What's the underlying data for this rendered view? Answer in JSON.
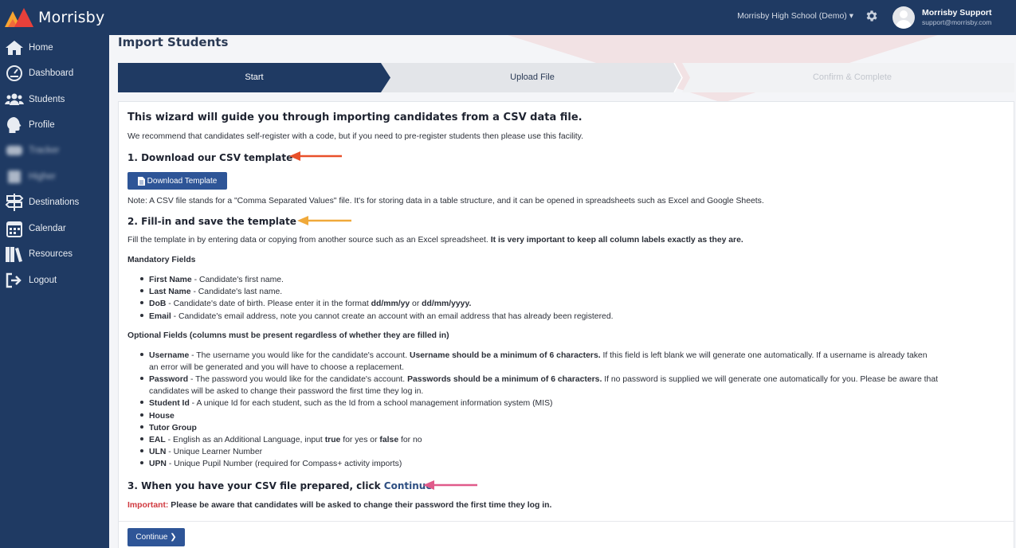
{
  "brand": {
    "name": "Morrisby"
  },
  "header": {
    "school": "Morrisby High School (Demo) ▾",
    "user_name": "Morrisby Support",
    "user_email": "support@morrisby.com"
  },
  "sidebar": {
    "items": [
      {
        "label": "Home",
        "icon": "home-icon"
      },
      {
        "label": "Dashboard",
        "icon": "dashboard-icon"
      },
      {
        "label": "Students",
        "icon": "students-icon"
      },
      {
        "label": "Profile",
        "icon": "profile-icon"
      },
      {
        "label": "Tracker",
        "icon": "tracker-icon"
      },
      {
        "label": "Higher",
        "icon": "higher-icon"
      },
      {
        "label": "Destinations",
        "icon": "signpost-icon"
      },
      {
        "label": "Calendar",
        "icon": "calendar-icon"
      },
      {
        "label": "Resources",
        "icon": "books-icon"
      },
      {
        "label": "Logout",
        "icon": "logout-icon"
      }
    ]
  },
  "page": {
    "title": "Import Students"
  },
  "wizard": {
    "steps": [
      {
        "label": "Start",
        "state": "active"
      },
      {
        "label": "Upload File",
        "state": "next"
      },
      {
        "label": "Confirm & Complete",
        "state": "disabled"
      }
    ]
  },
  "content": {
    "heading": "This wizard will guide you through importing candidates from a CSV data file.",
    "intro": "We recommend that candidates self-register with a code, but if you need to pre-register students then please use this facility.",
    "step1": {
      "title": "1. Download our CSV template",
      "button": "Download Template",
      "note": "Note: A CSV file stands for a \"Comma Separated Values\" file. It's for storing data in a table structure, and it can be opened in spreadsheets such as Excel and Google Sheets."
    },
    "step2": {
      "title": "2. Fill-in and save the template",
      "text": "Fill the template in by entering data or copying from another source such as an Excel spreadsheet.",
      "text_bold": "It is very important to keep all column labels exactly as they are.",
      "mandatory_title": "Mandatory Fields",
      "mandatory": [
        {
          "name": "First Name",
          "desc": " - Candidate's first name."
        },
        {
          "name": "Last Name",
          "desc": " - Candidate's last name."
        },
        {
          "name": "DoB",
          "desc": " - Candidate's date of birth. Please enter it in the format ",
          "f1": "dd/mm/yy",
          "or": " or ",
          "f2": "dd/mm/yyyy."
        },
        {
          "name": "Email",
          "desc": " - Candidate's email address, note you cannot create an account with an email address that has already been registered."
        }
      ],
      "optional_title": "Optional Fields (columns must be present regardless of whether they are filled in)",
      "optional": {
        "username_name": "Username",
        "username_desc": " - The username you would like for the candidate's account. ",
        "username_bold": "Username should be a minimum of 6 characters.",
        "username_rest": " If this field is left blank we will generate one automatically. If a username is already taken",
        "username_cont": "an error will be generated and you will have to choose a replacement.",
        "password_name": "Password",
        "password_desc": " - The password you would like for the candidate's account. ",
        "password_bold": "Passwords should be a minimum of 6 characters.",
        "password_rest": " If no password is supplied we will generate one automatically for you. Please be aware that",
        "password_cont": "candidates will be asked to change their password the first time they log in.",
        "studentid_name": "Student Id",
        "studentid_desc": " - A unique Id for each student, such as the Id from a school management information system (MIS)",
        "house_name": "House",
        "tutor_name": "Tutor Group",
        "eal_name": "EAL",
        "eal_desc": " - English as an Additional Language, input ",
        "eal_true": "true",
        "eal_mid": " for yes or ",
        "eal_false": "false",
        "eal_end": " for no",
        "uln_name": "ULN",
        "uln_desc": " - Unique Learner Number",
        "upn_name": "UPN",
        "upn_desc": " - Unique Pupil Number (required for Compass+ activity imports)"
      }
    },
    "step3": {
      "title": "3. When you have your CSV file prepared, click ",
      "title_link": "Continue",
      "important_label": "Important:",
      "important_text": " Please be aware that candidates will be asked to change their password the first time they log in."
    },
    "continue_button": "Continue ❯"
  },
  "colors": {
    "navy": "#1f3a63",
    "button": "#2e5597",
    "arrow1": "#e8502a",
    "arrow2": "#f0a93a",
    "arrow3": "#e05a8a"
  }
}
